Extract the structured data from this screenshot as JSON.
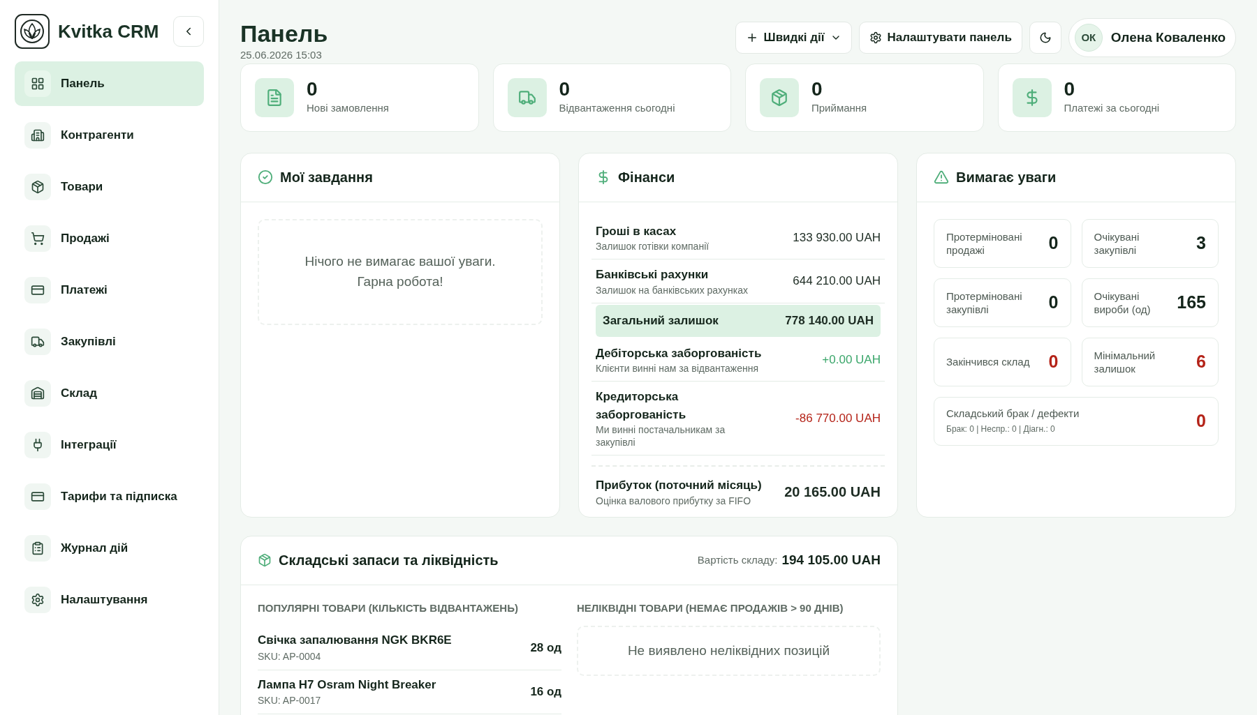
{
  "sidebar": {
    "brand": "Kvitka CRM",
    "items": [
      {
        "label": "Панель",
        "selected": true
      },
      {
        "label": "Контрагенти",
        "selected": false
      },
      {
        "label": "Товари",
        "selected": false
      },
      {
        "label": "Продажі",
        "selected": false
      },
      {
        "label": "Платежі",
        "selected": false
      },
      {
        "label": "Закупівлі",
        "selected": false
      },
      {
        "label": "Склад",
        "selected": false
      },
      {
        "label": "Інтеграції",
        "selected": false
      },
      {
        "label": "Тарифи та підписка",
        "selected": false
      },
      {
        "label": "Журнал дій",
        "selected": false
      },
      {
        "label": "Налаштування",
        "selected": false
      }
    ]
  },
  "header": {
    "title": "Панель",
    "datetime": "25.06.2026 15:03",
    "quick_actions": "Швидкі дії",
    "customize": "Налаштувати панель",
    "user": {
      "initials": "ОК",
      "name": "Олена Коваленко"
    }
  },
  "stats": [
    {
      "value": "0",
      "label": "Нові замовлення"
    },
    {
      "value": "0",
      "label": "Відвантаження сьогодні"
    },
    {
      "value": "0",
      "label": "Приймання"
    },
    {
      "value": "0",
      "label": "Платежі за сьогодні"
    }
  ],
  "tasks": {
    "title": "Мої завдання",
    "empty": [
      "Нічого не вимагає вашої уваги.",
      "Гарна робота!"
    ]
  },
  "finance": {
    "title": "Фінанси",
    "rows": [
      {
        "kind": "item",
        "label": "Гроші в касах",
        "sub": "Залишок готівки компанії",
        "value": "133 930.00 UAH",
        "color": "#1c2b22"
      },
      {
        "kind": "item",
        "label": "Банківські рахунки",
        "sub": "Залишок на банківських рахунках",
        "value": "644 210.00 UAH",
        "color": "#1c2b22"
      },
      {
        "kind": "total",
        "label": "Загальний залишок",
        "value": "778 140.00 UAH",
        "color": "#1c2b22"
      },
      {
        "kind": "item",
        "label": "Дебіторська заборгованість",
        "sub": "Клієнти винні нам за відвантаження",
        "value": "+0.00 UAH",
        "color": "#3aa66a"
      },
      {
        "kind": "item",
        "label": "Кредиторська заборгованість",
        "sub": "Ми винні постачальникам за закупівлі",
        "value": "-86 770.00 UAH",
        "color": "#b42318"
      },
      {
        "kind": "profit",
        "label": "Прибуток (поточний місяць)",
        "sub": "Оцінка валового прибутку за FIFO",
        "value": "20 165.00 UAH",
        "color": "#1c2b22"
      }
    ]
  },
  "attention": {
    "title": "Вимагає уваги",
    "tiles": [
      {
        "kind": "tile",
        "label": "Протерміновані продажі",
        "value": "0",
        "color": "#14251b"
      },
      {
        "kind": "tile",
        "label": "Очікувані закупівлі",
        "value": "3",
        "color": "#14251b"
      },
      {
        "kind": "tile",
        "label": "Протерміновані закупівлі",
        "value": "0",
        "color": "#14251b"
      },
      {
        "kind": "tile",
        "label": "Очікувані вироби (од)",
        "value": "165",
        "color": "#14251b"
      },
      {
        "kind": "tile",
        "label": "Закінчився склад",
        "value": "0",
        "color": "#b42318"
      },
      {
        "kind": "tile",
        "label": "Мінімальний залишок",
        "value": "6",
        "color": "#b42318"
      },
      {
        "kind": "wide",
        "label": "Складський брак / дефекти",
        "sub": "Брак: 0 | Неспр.: 0 | Діагн.: 0",
        "value": "0",
        "color": "#b42318"
      }
    ]
  },
  "stock": {
    "title": "Складські запаси та ліквідність",
    "value_label": "Вартість складу:",
    "value": "194 105.00 UAH",
    "popular_title": "ПОПУЛЯРНІ ТОВАРИ (КІЛЬКІСТЬ ВІДВАНТАЖЕНЬ)",
    "popular": [
      {
        "name": "Свічка запалювання NGK BKR6E",
        "sku": "SKU: AP-0004",
        "qty": "28 од"
      },
      {
        "name": "Лампа H7 Osram Night Breaker",
        "sku": "SKU: AP-0017",
        "qty": "16 од"
      }
    ],
    "illiquid_title": "НЕЛІКВІДНІ ТОВАРИ (НЕМАЄ ПРОДАЖІВ > 90 ДНІВ)",
    "illiquid_empty": "Не виявлено неліквідних позицій"
  }
}
